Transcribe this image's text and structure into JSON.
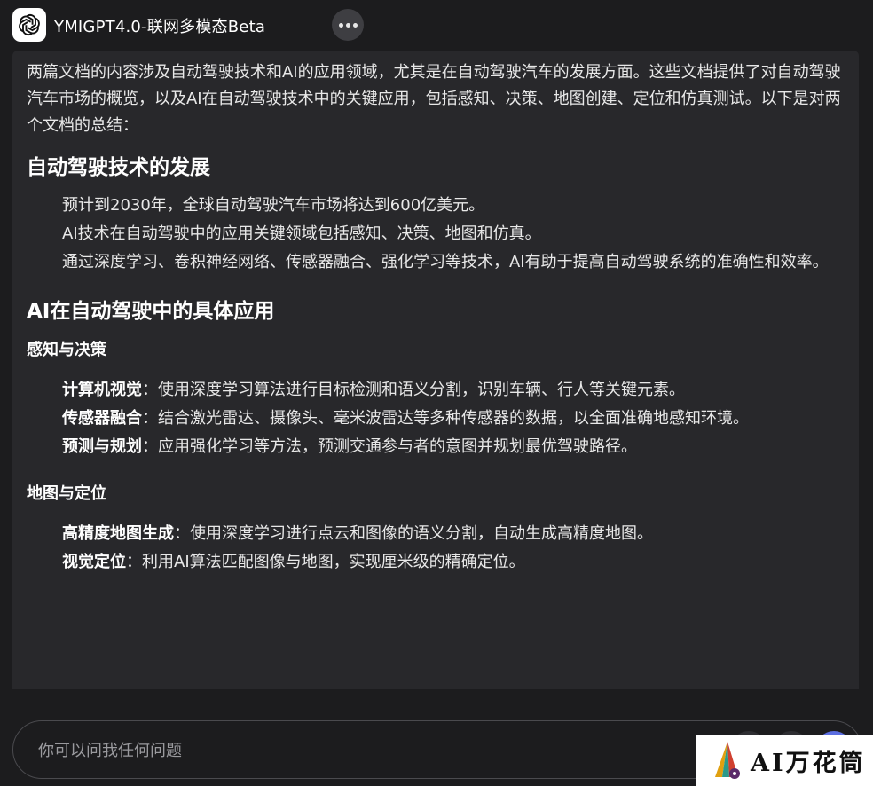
{
  "app": {
    "title": "YMIGPT4.0-联网多模态Beta",
    "logo_icon": "openai-logo-icon",
    "more_icon": "more-dots-icon"
  },
  "message": {
    "intro": "两篇文档的内容涉及自动驾驶技术和AI的应用领域，尤其是在自动驾驶汽车的发展方面。这些文档提供了对自动驾驶汽车市场的概览，以及AI在自动驾驶技术中的关键应用，包括感知、决策、地图创建、定位和仿真测试。以下是对两个文档的总结：",
    "section1": {
      "title": "自动驾驶技术的发展",
      "items": [
        "预计到2030年，全球自动驾驶汽车市场将达到600亿美元。",
        "AI技术在自动驾驶中的应用关键领域包括感知、决策、地图和仿真。",
        "通过深度学习、卷积神经网络、传感器融合、强化学习等技术，AI有助于提高自动驾驶系统的准确性和效率。"
      ]
    },
    "section2": {
      "title": "AI在自动驾驶中的具体应用",
      "sub1": {
        "title": "感知与决策",
        "items": [
          {
            "term": "计算机视觉",
            "desc": "：使用深度学习算法进行目标检测和语义分割，识别车辆、行人等关键元素。"
          },
          {
            "term": "传感器融合",
            "desc": "：结合激光雷达、摄像头、毫米波雷达等多种传感器的数据，以全面准确地感知环境。"
          },
          {
            "term": "预测与规划",
            "desc": "：应用强化学习等方法，预测交通参与者的意图并规划最优驾驶路径。"
          }
        ]
      },
      "sub2": {
        "title": "地图与定位",
        "items": [
          {
            "term": "高精度地图生成",
            "desc": "：使用深度学习进行点云和图像的语义分割，自动生成高精度地图。"
          },
          {
            "term": "视觉定位",
            "desc": "：利用AI算法匹配图像与地图，实现厘米级的精确定位。"
          }
        ]
      }
    }
  },
  "input": {
    "placeholder": "你可以问我任何问题"
  },
  "watermark": {
    "text": "AI万花筒",
    "logo_icon": "wanhuatong-logo-icon"
  },
  "colors": {
    "background": "#1c1c1e",
    "message_bg": "#28282b",
    "send_accent": "#5b6ee1"
  }
}
